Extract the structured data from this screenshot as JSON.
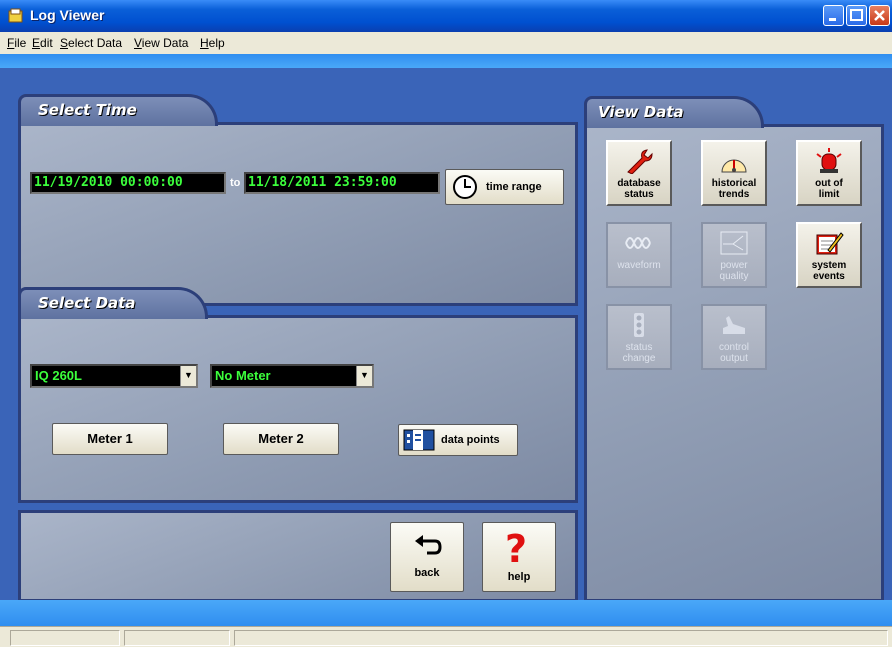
{
  "window": {
    "title": "Log Viewer"
  },
  "menu": [
    {
      "label": "File",
      "u": "F",
      "rest": "ile"
    },
    {
      "label": "Edit",
      "u": "E",
      "rest": "dit"
    },
    {
      "label": "Select Data",
      "u": "S",
      "rest": "elect Data"
    },
    {
      "label": "View Data",
      "u": "V",
      "rest": "iew Data"
    },
    {
      "label": "Help",
      "u": "H",
      "rest": "elp"
    }
  ],
  "select_time": {
    "heading": "Select Time",
    "start": "11/19/2010 00:00:00",
    "to_label": "to",
    "end": "11/18/2011 23:59:00",
    "time_range_label": "time range"
  },
  "select_data": {
    "heading": "Select Data",
    "meter1_select": "IQ 260L",
    "meter2_select": "No Meter",
    "meter1_button": "Meter 1",
    "meter2_button": "Meter 2",
    "data_points_label": "data points"
  },
  "nav": {
    "back": "back",
    "help": "help"
  },
  "view_data": {
    "heading": "View Data",
    "tiles": [
      {
        "line1": "database",
        "line2": "status",
        "enabled": true
      },
      {
        "line1": "historical",
        "line2": "trends",
        "enabled": true
      },
      {
        "line1": "out of",
        "line2": "limit",
        "enabled": true
      },
      {
        "line1": "waveform",
        "line2": "",
        "enabled": false
      },
      {
        "line1": "power",
        "line2": "quality",
        "enabled": false
      },
      {
        "line1": "system",
        "line2": "events",
        "enabled": true
      },
      {
        "line1": "status",
        "line2": "change",
        "enabled": false
      },
      {
        "line1": "control",
        "line2": "output",
        "enabled": false
      }
    ]
  },
  "colors": {
    "lcd_text": "#3cff3c",
    "panel_border": "#2c3f7a",
    "titlebar": "#0050d0"
  }
}
